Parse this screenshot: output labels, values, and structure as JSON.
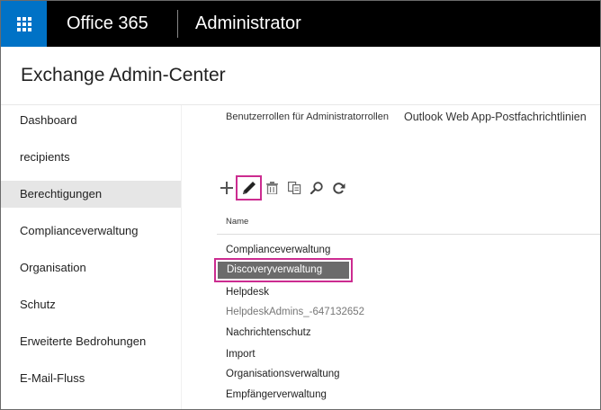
{
  "topbar": {
    "brand": "Office 365",
    "role": "Administrator"
  },
  "app_title": "Exchange Admin-Center",
  "sidebar": {
    "items": [
      {
        "label": "Dashboard",
        "active": false
      },
      {
        "label": "recipients",
        "active": false
      },
      {
        "label": "Berechtigungen",
        "active": true
      },
      {
        "label": "Complianceverwaltung",
        "active": false
      },
      {
        "label": "Organisation",
        "active": false
      },
      {
        "label": "Schutz",
        "active": false
      },
      {
        "label": "Erweiterte Bedrohungen",
        "active": false
      },
      {
        "label": "E-Mail-Fluss",
        "active": false
      }
    ]
  },
  "tabs": [
    {
      "label": "Benutzerrollen für Administratorrollen"
    },
    {
      "label": "Outlook Web App-Postfachrichtlinien"
    }
  ],
  "toolbar": {
    "buttons": [
      {
        "icon": "plus-icon"
      },
      {
        "icon": "pencil-icon",
        "highlighted": true
      },
      {
        "icon": "trash-icon"
      },
      {
        "icon": "copy-icon"
      },
      {
        "icon": "search-icon"
      },
      {
        "icon": "refresh-icon"
      }
    ]
  },
  "list": {
    "column_header": "Name",
    "rows": [
      {
        "label": "Complianceverwaltung",
        "muted": false
      },
      {
        "label": "Discoveryverwaltung",
        "selected": true
      },
      {
        "label": "Helpdesk",
        "muted": false
      },
      {
        "label": "HelpdeskAdmins_-647132652",
        "muted": true
      },
      {
        "label": "Nachrichtenschutz",
        "muted": false
      },
      {
        "label": "Import",
        "muted": false
      },
      {
        "label": "Organisationsverwaltung",
        "muted": false
      },
      {
        "label": "Empfängerverwaltung",
        "muted": false
      }
    ]
  },
  "colors": {
    "waffle_bg": "#0072c6",
    "topbar_bg": "#000000",
    "highlight": "#cc2c90",
    "selected_row_bg": "#6b6b6b"
  }
}
